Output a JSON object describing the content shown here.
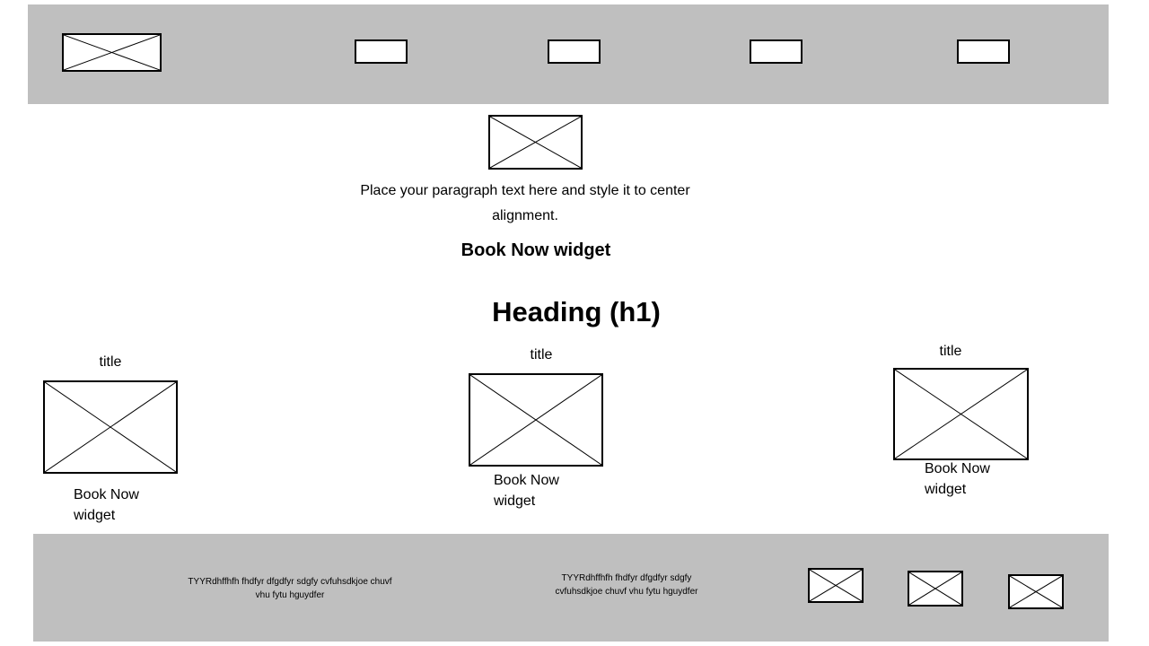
{
  "hero": {
    "paragraph_line1": "Place your paragraph text here and style it to center",
    "paragraph_line2": "alignment.",
    "book_now": "Book Now widget"
  },
  "section": {
    "heading": "Heading (h1)",
    "cards": [
      {
        "title": "title",
        "book_line1": "Book Now",
        "book_line2": "widget"
      },
      {
        "title": "title",
        "book_line1": "Book Now",
        "book_line2": "widget"
      },
      {
        "title": "title",
        "book_line1": "Book Now",
        "book_line2": "widget"
      }
    ]
  },
  "footer": {
    "text1_line1": "TYYRdhffhfh fhdfyr dfgdfyr sdgfy cvfuhsdkjoe chuvf",
    "text1_line2": "vhu fytu hguydfer",
    "text2_line1": "TYYRdhffhfh fhdfyr dfgdfyr sdgfy",
    "text2_line2": "cvfuhsdkjoe chuvf vhu fytu hguydfer"
  },
  "colors": {
    "bar_background": "#bfbfbf",
    "placeholder_stroke": "#000000",
    "page_background": "#ffffff"
  }
}
